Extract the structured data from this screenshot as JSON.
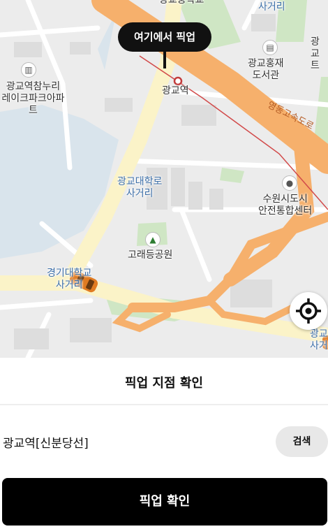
{
  "map": {
    "pickup_bubble": "여기에서 픽업",
    "labels": {
      "top_cut": "광교중학교",
      "intersection_top": "사거리",
      "apartment": "광교역참누리\n레이크파크아파트",
      "station": "광교역",
      "library": "광교홍재\n도서관",
      "expressway": "영동고속도로",
      "univ_intersection": "광교대학로\n사거리",
      "safety_center": "수원시도시\n안전통합센터",
      "park": "고래등공원",
      "west_intersection": "경기대학교\n사거리",
      "right_top": "광교\n트",
      "right_bottom": "광교\n사거"
    },
    "icons": {
      "apartment": "building-icon",
      "library": "book-icon",
      "safety_center": "facility-icon",
      "park": "tree-icon",
      "locate": "crosshair-icon"
    }
  },
  "panel": {
    "title": "픽업 지점 확인",
    "location_name": "광교역[신분당선]",
    "search_label": "검색",
    "confirm_label": "픽업 확인"
  }
}
